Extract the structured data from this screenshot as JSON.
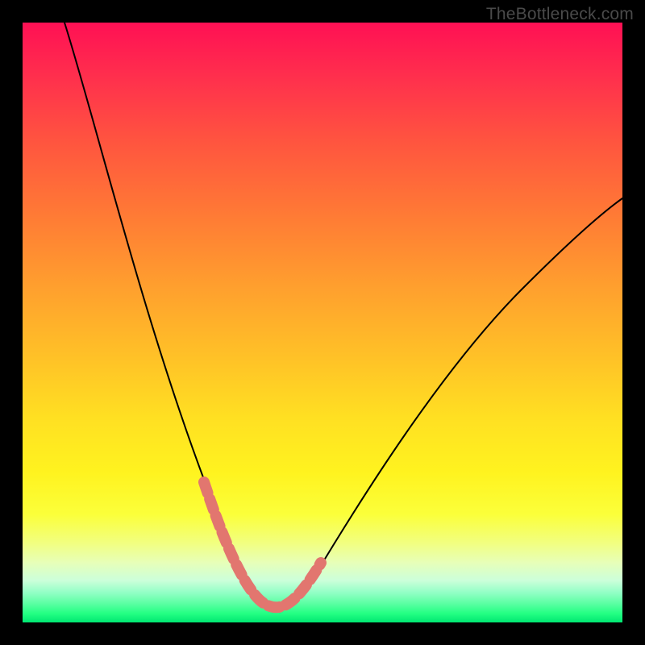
{
  "watermark": "TheBottleneck.com",
  "colors": {
    "curve": "#000000",
    "marker": "#e2766f",
    "frame_bg_top": "#ff1054",
    "frame_bg_bottom": "#00e772",
    "page_bg": "#000000"
  },
  "chart_data": {
    "type": "line",
    "title": "",
    "xlabel": "",
    "ylabel": "",
    "xlim": [
      0,
      100
    ],
    "ylim": [
      0,
      100
    ],
    "grid": false,
    "series": [
      {
        "name": "bottleneck-curve",
        "x": [
          7,
          10,
          13,
          16,
          19,
          22,
          25,
          28,
          31,
          33,
          35,
          37,
          39,
          41,
          43,
          45,
          48,
          52,
          56,
          60,
          65,
          70,
          75,
          80,
          85,
          90,
          95,
          100
        ],
        "y": [
          100,
          89,
          78,
          68,
          58,
          49,
          40,
          32,
          24,
          18,
          13,
          8,
          4,
          1,
          0,
          1,
          4,
          9,
          15,
          22,
          30,
          38,
          45,
          52,
          58,
          63,
          67,
          70
        ]
      }
    ],
    "annotations": [
      {
        "name": "optimal-range-marker",
        "x": [
          31,
          33,
          35,
          37,
          39,
          41,
          43,
          45,
          47,
          49
        ],
        "y": [
          22,
          16,
          10,
          6,
          2,
          0,
          0,
          2,
          6,
          11
        ]
      }
    ]
  }
}
